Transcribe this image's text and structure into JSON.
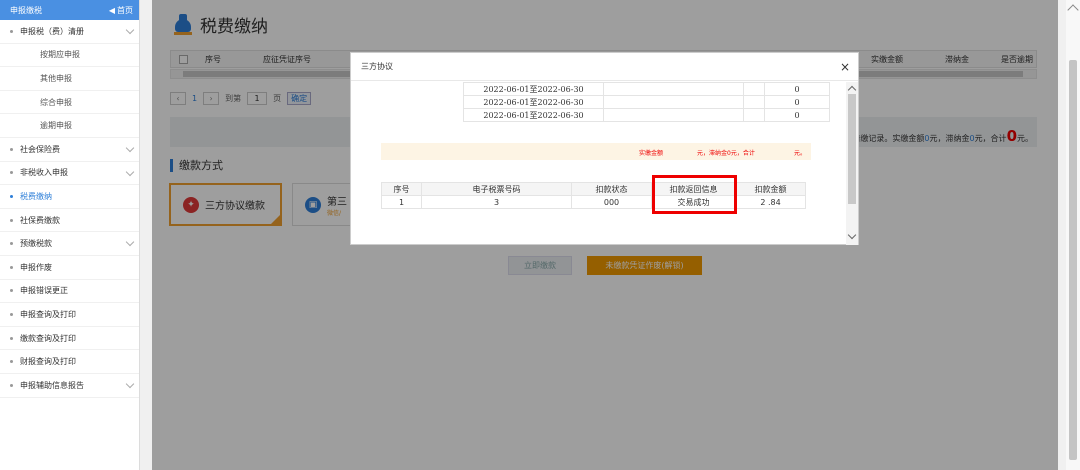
{
  "sidebar": {
    "header_title": "申报缴税",
    "home_label": "首页",
    "items": [
      {
        "label": "申报税（费）清册",
        "type": "group"
      },
      {
        "label": "按期应申报",
        "type": "sub"
      },
      {
        "label": "其他申报",
        "type": "sub"
      },
      {
        "label": "综合申报",
        "type": "sub"
      },
      {
        "label": "逾期申报",
        "type": "sub"
      },
      {
        "label": "社会保险费",
        "type": "group"
      },
      {
        "label": "非税收入申报",
        "type": "group"
      },
      {
        "label": "税费缴纳",
        "type": "item",
        "active": true
      },
      {
        "label": "社保费缴款",
        "type": "item"
      },
      {
        "label": "预缴税款",
        "type": "group"
      },
      {
        "label": "申报作废",
        "type": "item"
      },
      {
        "label": "申报错误更正",
        "type": "item"
      },
      {
        "label": "申报查询及打印",
        "type": "item"
      },
      {
        "label": "缴款查询及打印",
        "type": "item"
      },
      {
        "label": "财报查询及打印",
        "type": "item"
      },
      {
        "label": "申报辅助信息报告",
        "type": "group"
      }
    ]
  },
  "page": {
    "title": "税费缴纳",
    "table_headers": {
      "seq": "序号",
      "voucher": "应征凭证序号",
      "actual": "实缴金额",
      "late_fee": "滞纳金",
      "overdue": "是否逾期"
    },
    "pager": {
      "current": "1",
      "goto_label": "到第",
      "goto_value": "1",
      "page_unit": "页",
      "confirm": "确定"
    },
    "summary": {
      "prefix": "清缴记录。实缴金额",
      "actual": "0",
      "mid1": "元，滞纳金",
      "late": "0",
      "mid2": "元，合计",
      "total": "0",
      "suffix": "元。"
    },
    "section_title": "缴款方式",
    "pay_methods": {
      "selected_label": "三方协议缴款",
      "other_label": "第三",
      "other_sub": "微信/"
    },
    "buttons": {
      "pay_now": "立即缴款",
      "void_voucher": "未缴款凭证作废(解锁)"
    }
  },
  "modal": {
    "title": "三方协议",
    "close": "×",
    "periods": [
      {
        "period": "2022-06-01至2022-06-30",
        "amount": "0"
      },
      {
        "period": "2022-06-01至2022-06-30",
        "amount": "0"
      },
      {
        "period": "2022-06-01至2022-06-30",
        "amount": "0"
      }
    ],
    "notice": {
      "actual": "实缴金额",
      "late": "元，滞纳金0元，合计",
      "end": "元。"
    },
    "result": {
      "headers": [
        "序号",
        "电子税票号码",
        "扣款状态",
        "扣款返回信息",
        "扣款金额"
      ],
      "rows": [
        {
          "seq": "1",
          "ticket": "3",
          "status": "000",
          "message": "交易成功",
          "amount": "2      .84"
        }
      ]
    }
  }
}
